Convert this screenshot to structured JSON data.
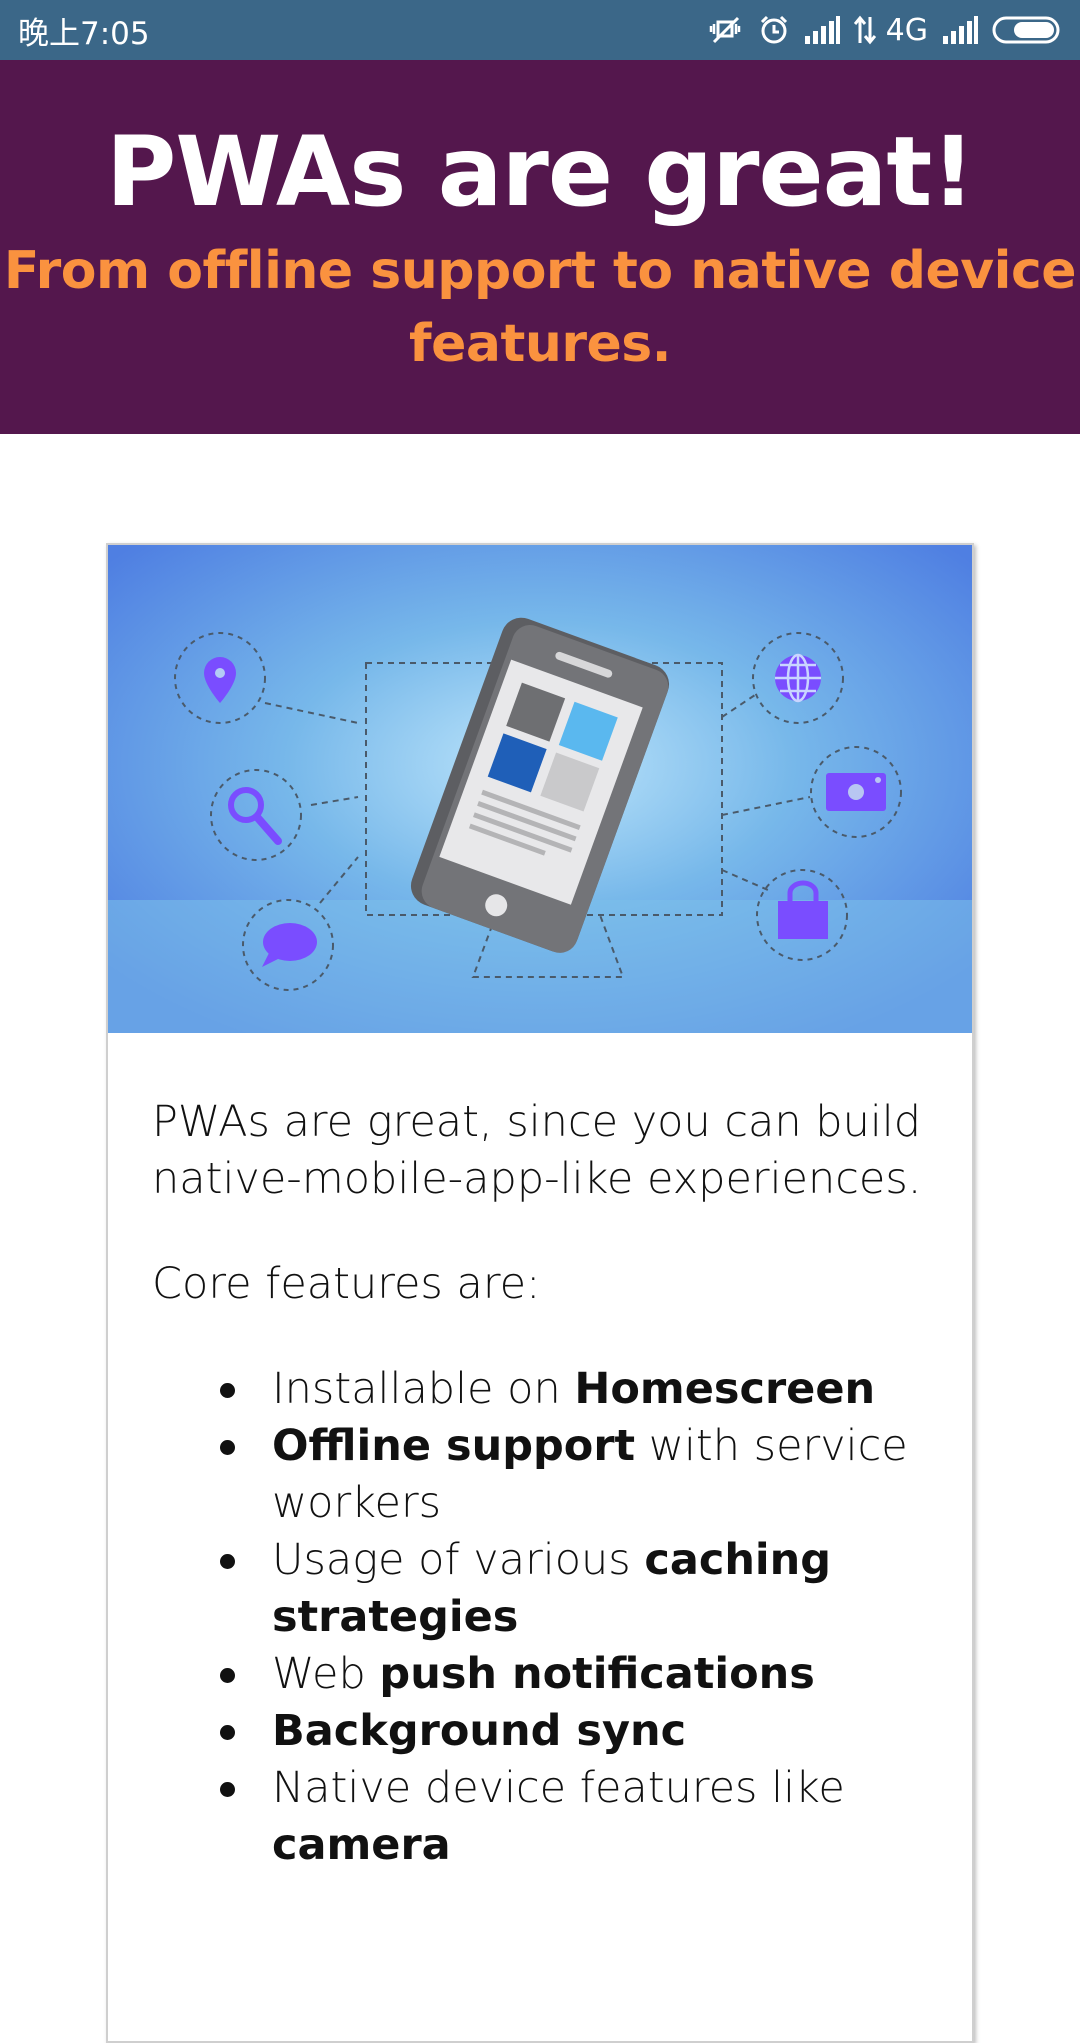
{
  "status_bar": {
    "time": "晚上7:05",
    "network": "4G",
    "icons": [
      "vibrate-off-icon",
      "alarm-icon",
      "signal-icon",
      "data-arrows-icon",
      "signal-icon",
      "battery-icon"
    ],
    "background": "#3b6788"
  },
  "hero": {
    "title": "PWAs are great!",
    "subtitle": "From offline support to native device features.",
    "background": "#54174d",
    "subtitle_color": "#fa923f"
  },
  "card": {
    "image_icons": [
      "location-pin-icon",
      "search-icon",
      "chat-bubble-icon",
      "globe-icon",
      "camera-icon",
      "shopping-bag-icon",
      "smartphone-icon"
    ],
    "intro": "PWAs are great, since you can build native-mobile-app-like experiences.",
    "core_label": "Core features are:",
    "features": [
      {
        "pre": "Installable on ",
        "bold": "Homescreen",
        "post": ""
      },
      {
        "pre": "",
        "bold": "Offline support",
        "post": " with service workers"
      },
      {
        "pre": "Usage of various ",
        "bold": "caching strategies",
        "post": ""
      },
      {
        "pre": "Web ",
        "bold": "push notifications",
        "post": ""
      },
      {
        "pre": "",
        "bold": "Background sync",
        "post": ""
      },
      {
        "pre": "Native device features like ",
        "bold": "camera",
        "post": ""
      }
    ]
  }
}
